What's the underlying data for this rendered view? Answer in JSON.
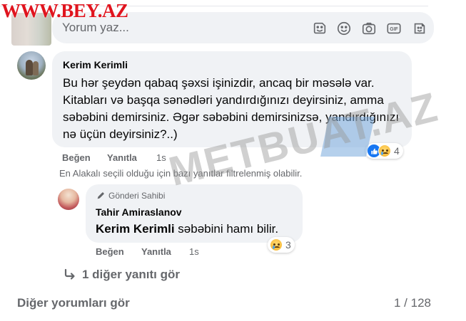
{
  "site_logo": "WWW.BEY.AZ",
  "watermark": "METBUAT.AZ",
  "composer": {
    "placeholder": "Yorum yaz...",
    "icons": [
      "sticker-icon",
      "emoji-icon",
      "camera-icon",
      "gif-icon",
      "avatar-sticker-icon"
    ]
  },
  "comment": {
    "author": "Kerim Kerimli",
    "text": "Bu hər şeydən qabaq şəxsi işinizdir, ancaq bir məsələ var. Kitabları və başqa sənədləri yandırdığınızı deyirsiniz, amma səbəbini demirsiniz. Əgər səbəbini demirsinizsə, yandırdığınızı nə üçün deyirsiniz?..)",
    "like_label": "Beğen",
    "reply_label": "Yanıtla",
    "time": "1s",
    "reactions": [
      "like",
      "sad"
    ],
    "reaction_count": "4"
  },
  "filter_note": "En Alakalı seçili olduğu için bazı yanıtlar filtrelenmiş olabilir.",
  "reply": {
    "badge": "Gönderi Sahibi",
    "author": "Tahir Amiraslanov",
    "mention": "Kerim Kerimli",
    "text": "səbəbini hamı bilir.",
    "like_label": "Beğen",
    "reply_label": "Yanıtla",
    "time": "1s",
    "reactions": [
      "sad"
    ],
    "reaction_count": "3"
  },
  "more_replies": "1 diğer yanıtı gör",
  "footer": {
    "more_comments": "Diğer yorumları gör",
    "pagination": "1 / 128"
  }
}
